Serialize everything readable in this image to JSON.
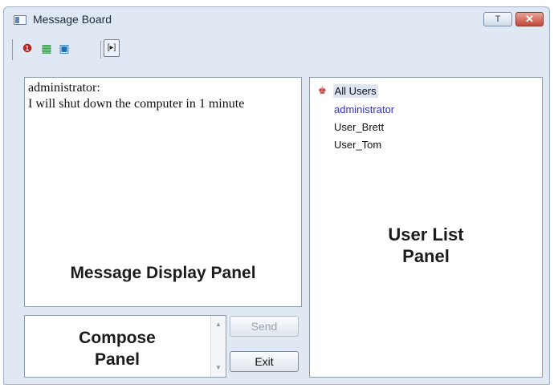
{
  "window": {
    "title": "Message Board",
    "min_glyph": "T",
    "close_glyph": "✕"
  },
  "toolbar": {
    "icons": [
      "user-stop-icon",
      "user-monitor-icon",
      "monitor-icon",
      "layout-toggle-icon"
    ],
    "glyphs": [
      "❶",
      "▦",
      "▣",
      "[▸]"
    ]
  },
  "message_panel": {
    "sender": "administrator:",
    "body": "I will shut down the computer in 1 minute",
    "label": "Message Display Panel"
  },
  "compose_panel": {
    "value": "",
    "label_line1": "Compose",
    "label_line2": "Panel"
  },
  "buttons": {
    "send": "Send",
    "exit": "Exit"
  },
  "user_list": {
    "all_users": "All Users",
    "items": [
      "administrator",
      "User_Brett",
      "User_Tom"
    ],
    "selected_color": "#2d2fd3",
    "label_line1": "User List",
    "label_line2": "Panel"
  }
}
